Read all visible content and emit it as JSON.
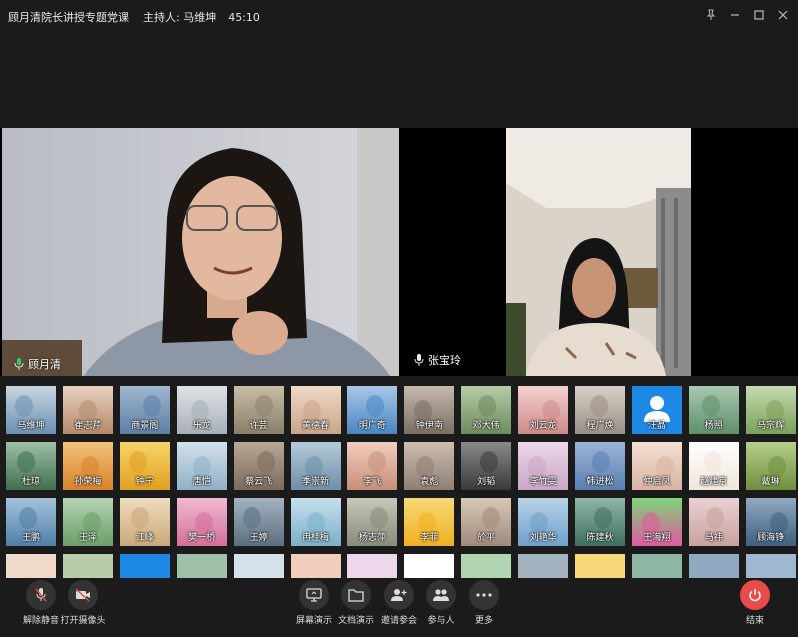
{
  "title": "顾月清院长讲授专题党课",
  "host_label": "主持人: 马维坤",
  "timer": "45:10",
  "speakers": [
    {
      "name": "顾月清"
    },
    {
      "name": "张宝玲"
    }
  ],
  "participants": [
    "马维坤",
    "崔志芹",
    "商景阁",
    "乐龙",
    "许芸",
    "黄德春",
    "明广奇",
    "钟伊南",
    "邓大伟",
    "刘云龙",
    "程广焕",
    "汪晶",
    "杨照",
    "马宗辉",
    "杜琼",
    "孙荣梅",
    "钟宁",
    "唐恺",
    "蔡云飞",
    "季崇新",
    "李飞",
    "袁彪",
    "刘韬",
    "李竹雯",
    "韩进松",
    "仲启凤",
    "赵建京",
    "戴琳",
    "王鹏",
    "王泽",
    "江峰",
    "樊一桥",
    "王婷",
    "冉桂梅",
    "杨志萍",
    "李菲",
    "於平",
    "刘艳华",
    "陈建秋",
    "王海翔",
    "马祎",
    "顾海铮"
  ],
  "toolbar": {
    "unmute": "解除静音",
    "camera": "打开摄像头",
    "share": "屏幕演示",
    "doc": "文档演示",
    "invite": "邀请参会",
    "members": "参与人",
    "more": "更多",
    "end": "结束"
  },
  "colors": {
    "background": "#1b1b1b",
    "end_button": "#e94b4b",
    "avatar_default": "#1e88e5"
  }
}
